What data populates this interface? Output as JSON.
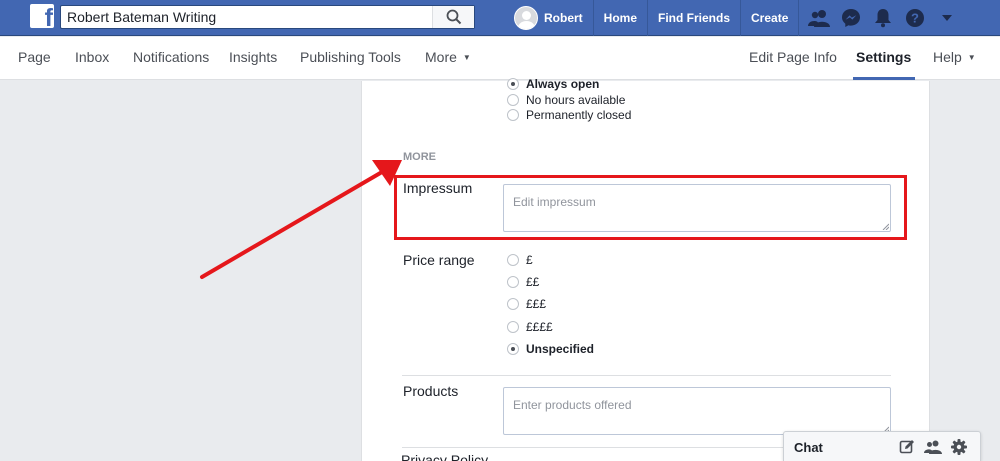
{
  "topbar": {
    "search_value": "Robert Bateman Writing",
    "user_name": "Robert",
    "nav": [
      "Home",
      "Find Friends",
      "Create"
    ],
    "icons": [
      "friends-icon",
      "messenger-icon",
      "notifications-icon",
      "help-icon",
      "caret-down-icon"
    ]
  },
  "pagebar": {
    "left_tabs": [
      "Page",
      "Inbox",
      "Notifications",
      "Insights",
      "Publishing Tools",
      "More"
    ],
    "right_tabs": [
      "Edit Page Info",
      "Settings",
      "Help"
    ],
    "active": "Settings"
  },
  "hours": {
    "options": [
      {
        "label": "Always open",
        "checked": true
      },
      {
        "label": "No hours available",
        "checked": false
      },
      {
        "label": "Permanently closed",
        "checked": false
      }
    ]
  },
  "more": {
    "heading": "MORE",
    "impressum_label": "Impressum",
    "impressum_placeholder": "Edit impressum",
    "price_label": "Price range",
    "price_options": [
      {
        "label": "£",
        "checked": false
      },
      {
        "label": "££",
        "checked": false
      },
      {
        "label": "£££",
        "checked": false
      },
      {
        "label": "££££",
        "checked": false
      },
      {
        "label": "Unspecified",
        "checked": true
      }
    ],
    "products_label": "Products",
    "products_placeholder": "Enter products offered",
    "privacy_label": "Privacy Policy"
  },
  "chat": {
    "label": "Chat",
    "icons": [
      "compose-icon",
      "friends-icon",
      "gear-icon"
    ]
  },
  "colors": {
    "fb_blue": "#4267b2",
    "annotation_red": "#e5171b"
  }
}
